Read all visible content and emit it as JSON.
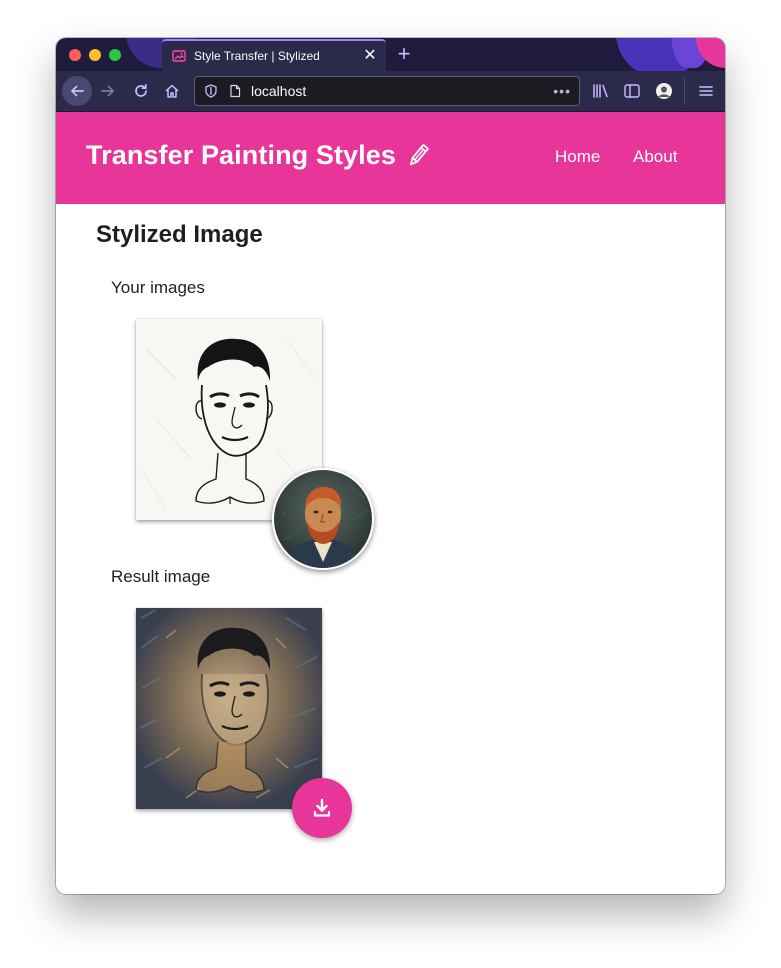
{
  "browser": {
    "tab": {
      "title": "Style Transfer | Stylized",
      "favicon": "image-icon"
    },
    "url": "localhost",
    "url_more": "•••"
  },
  "site": {
    "brand": "Transfer Painting Styles",
    "nav": {
      "home": "Home",
      "about": "About"
    }
  },
  "page": {
    "heading": "Stylized Image",
    "your_images_label": "Your images",
    "result_label": "Result image"
  },
  "colors": {
    "accent": "#e7359a",
    "browser_chrome": "#2b2a4a",
    "tab_accent": "#a27df8"
  },
  "icons": {
    "brand": "pencil-icon",
    "download": "download-icon"
  }
}
